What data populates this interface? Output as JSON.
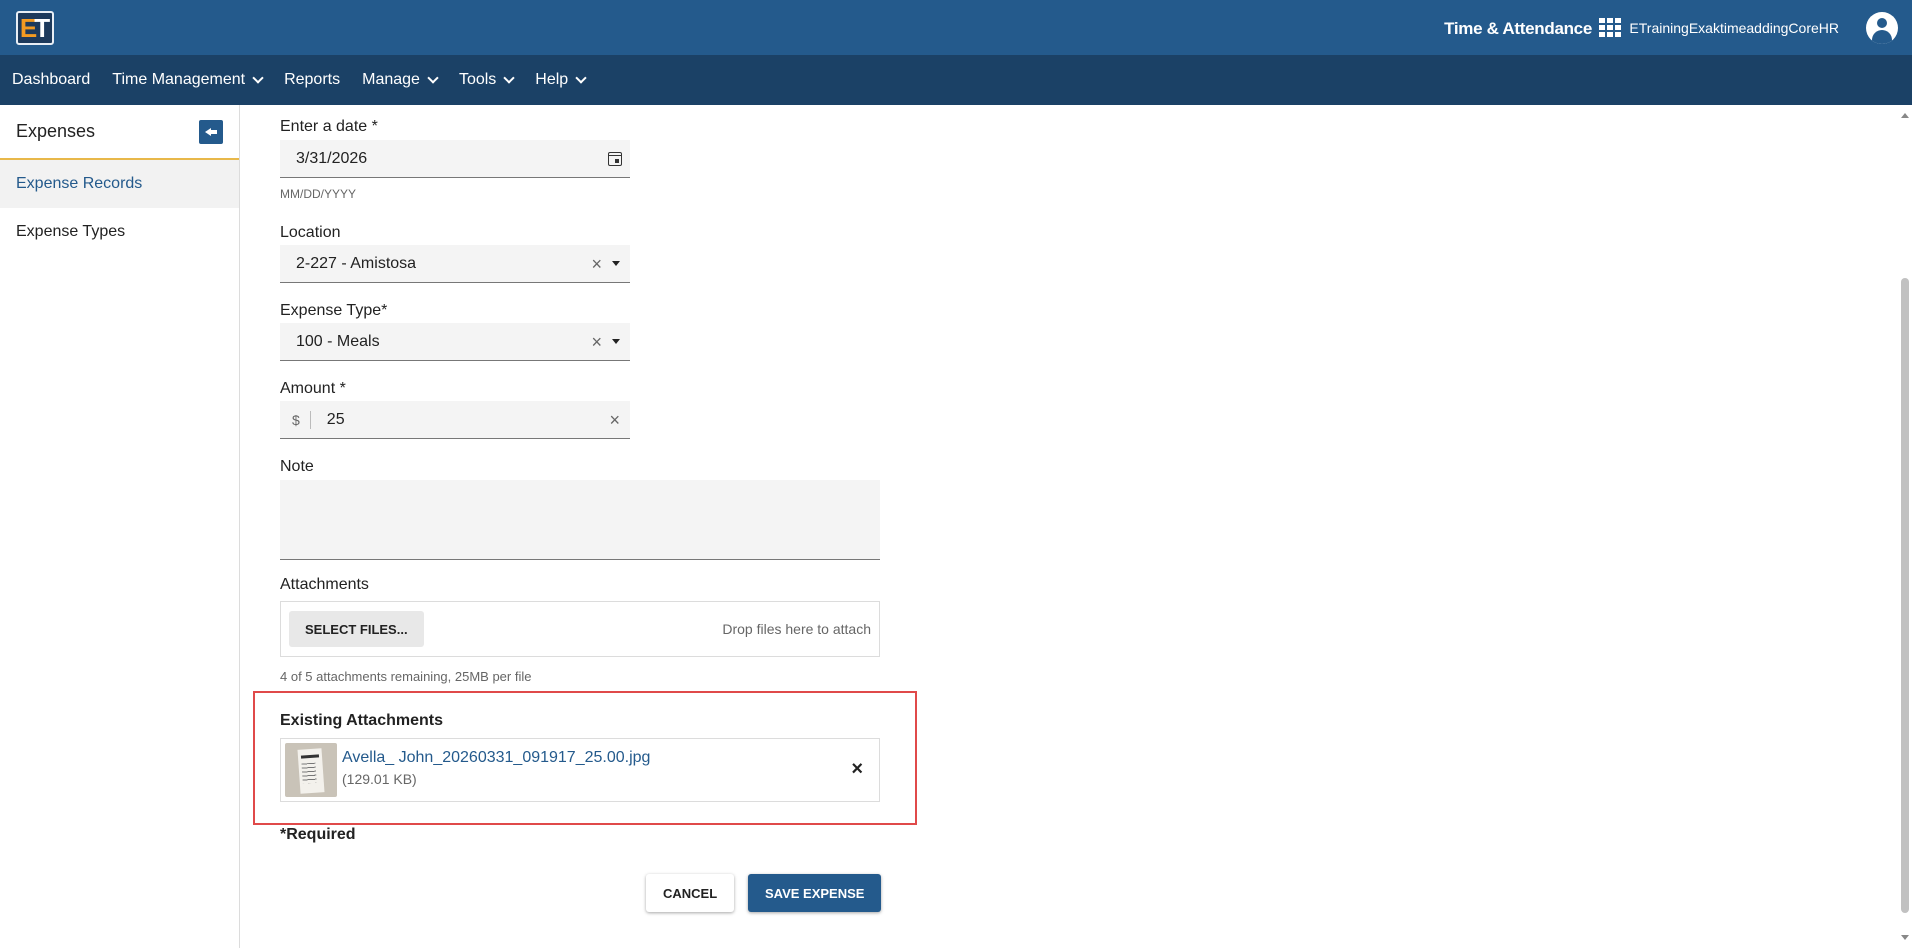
{
  "header": {
    "logo_letter_e": "E",
    "logo_letter_t": "T",
    "product_name": "Time & Attendance",
    "apps_icon": "grid-icon",
    "username": "ETrainingExaktimeaddingCoreHR",
    "avatar_icon": "user-avatar-icon"
  },
  "nav": {
    "items": [
      {
        "label": "Dashboard",
        "has_menu": false
      },
      {
        "label": "Time Management",
        "has_menu": true
      },
      {
        "label": "Reports",
        "has_menu": false
      },
      {
        "label": "Manage",
        "has_menu": true
      },
      {
        "label": "Tools",
        "has_menu": true
      },
      {
        "label": "Help",
        "has_menu": true
      }
    ]
  },
  "sidebar": {
    "title": "Expenses",
    "items": [
      {
        "label": "Expense Records",
        "active": true
      },
      {
        "label": "Expense Types",
        "active": false
      }
    ]
  },
  "form": {
    "date": {
      "label": "Enter a date *",
      "value": "3/31/2026",
      "hint": "MM/DD/YYYY"
    },
    "location": {
      "label": "Location",
      "value": "2-227 - Amistosa"
    },
    "expense_type": {
      "label": "Expense Type*",
      "value": "100 - Meals"
    },
    "amount": {
      "label": "Amount *",
      "prefix": "$",
      "value": "25"
    },
    "note": {
      "label": "Note",
      "value": ""
    },
    "attachments": {
      "label": "Attachments",
      "select_button": "SELECT FILES...",
      "drop_text": "Drop files here to attach",
      "remaining": "4 of 5 attachments remaining, 25MB per file"
    },
    "existing": {
      "title": "Existing Attachments",
      "files": [
        {
          "name": "Avella_ John_20260331_091917_25.00.jpg",
          "size": "(129.01 KB)"
        }
      ]
    },
    "required_note": "*Required",
    "cancel_label": "CANCEL",
    "save_label": "SAVE EXPENSE"
  },
  "colors": {
    "topbar": "#245a8c",
    "navbar": "#1b4166",
    "accent": "#245a8c",
    "logo_accent": "#f39a21",
    "sidebar_underline": "#e8b84a",
    "highlight": "#e04a4a"
  }
}
